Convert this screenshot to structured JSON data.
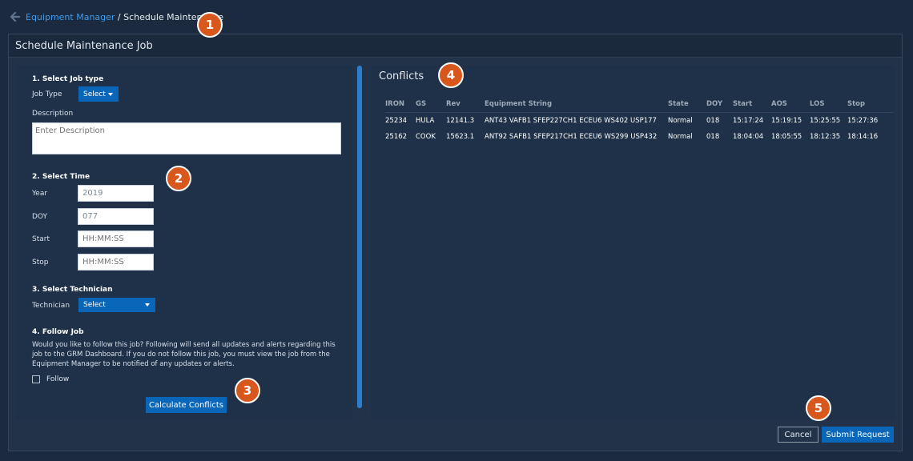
{
  "breadcrumb": {
    "parent": "Equipment Manager",
    "separator": " / ",
    "current": "Schedule Maintenance"
  },
  "window_title": "Schedule Maintenance Job",
  "job_type": {
    "section_title": "1. Select Job type",
    "job_type_label": "Job Type",
    "job_type_value": "Select",
    "description_label": "Description",
    "description_placeholder": "Enter Description"
  },
  "time": {
    "section_title": "2. Select Time",
    "year_label": "Year",
    "year_value": "2019",
    "doy_label": "DOY",
    "doy_value": "077",
    "start_label": "Start",
    "start_placeholder": "HH:MM:SS",
    "stop_label": "Stop",
    "stop_placeholder": "HH:MM:SS"
  },
  "technician": {
    "section_title": "3. Select Technician",
    "label": "Technician",
    "value": "Select"
  },
  "follow": {
    "section_title": "4. Follow Job",
    "description": "Would you like to follow this job? Following will send all updates and alerts regarding this job to the GRM Dashboard. If you do not follow this job, you must view the job from the Equipment Manager to be notified of any updates or alerts.",
    "checkbox_label": "Follow",
    "checked": false
  },
  "calculate_button": "Calculate Conflicts",
  "conflicts": {
    "title": "Conflicts",
    "columns": [
      "IRON",
      "GS",
      "Rev",
      "Equipment String",
      "State",
      "DOY",
      "Start",
      "AOS",
      "LOS",
      "Stop"
    ],
    "rows": [
      [
        "25234",
        "HULA",
        "12141.3",
        "ANT43 VAFB1 SFEP227CH1 ECEU6 WS402 USP177",
        "Normal",
        "018",
        "15:17:24",
        "15:19:15",
        "15:25:55",
        "15:27:36"
      ],
      [
        "25162",
        "COOK",
        "15623.1",
        "ANT92 SAFB1 SFEP217CH1 ECEU6 WS299 USP432",
        "Normal",
        "018",
        "18:04:04",
        "18:05:55",
        "18:12:35",
        "18:14:16"
      ]
    ]
  },
  "footer": {
    "cancel": "Cancel",
    "submit": "Submit Request"
  },
  "callouts": [
    "1",
    "2",
    "3",
    "4",
    "5"
  ],
  "colors": {
    "background": "#1b2a3e",
    "panel": "#1e3148",
    "accent": "#0a66b8",
    "link": "#3d9cf0",
    "callout": "#d8571c"
  }
}
